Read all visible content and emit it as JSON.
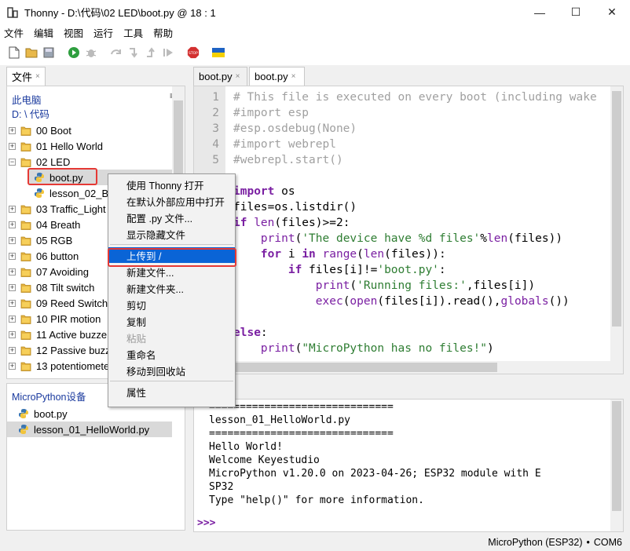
{
  "window": {
    "title": "Thonny  -  D:\\代码\\02 LED\\boot.py  @  18 : 1",
    "minimize": "—",
    "maximize": "☐",
    "close": "✕"
  },
  "menubar": [
    "文件",
    "编辑",
    "视图",
    "运行",
    "工具",
    "帮助"
  ],
  "toolbar": [
    "new-file-icon",
    "open-file-icon",
    "save-icon",
    "run-icon",
    "debug-icon",
    "step-over-icon",
    "step-into-icon",
    "step-out-icon",
    "resume-icon",
    "stop-icon",
    "ukraine-flag-icon"
  ],
  "stop_label": "STOP",
  "files_panel": {
    "tab": "文件",
    "location_title": "此电脑",
    "location_path": "D: \\ 代码",
    "menu_glyph": "≡",
    "items": [
      {
        "label": "00 Boot",
        "type": "folder",
        "expand": "+"
      },
      {
        "label": "01 Hello World",
        "type": "folder",
        "expand": "+"
      },
      {
        "label": "02 LED",
        "type": "folder",
        "expand": "−"
      },
      {
        "label": "boot.py",
        "type": "file"
      },
      {
        "label": "lesson_02_Bl",
        "type": "file"
      },
      {
        "label": "03 Traffic_Light",
        "type": "folder",
        "expand": "+"
      },
      {
        "label": "04 Breath",
        "type": "folder",
        "expand": "+"
      },
      {
        "label": "05 RGB",
        "type": "folder",
        "expand": "+"
      },
      {
        "label": "06 button",
        "type": "folder",
        "expand": "+"
      },
      {
        "label": "07 Avoiding",
        "type": "folder",
        "expand": "+"
      },
      {
        "label": "08 Tilt switch",
        "type": "folder",
        "expand": "+"
      },
      {
        "label": "09 Reed Switch",
        "type": "folder",
        "expand": "+"
      },
      {
        "label": "10 PIR motion",
        "type": "folder",
        "expand": "+"
      },
      {
        "label": "11 Active buzzer",
        "type": "folder",
        "expand": "+"
      },
      {
        "label": "12 Passive buzze",
        "type": "folder",
        "expand": "+"
      },
      {
        "label": "13 potentiomete",
        "type": "folder",
        "expand": "+"
      }
    ]
  },
  "device_panel": {
    "title": "MicroPython设备",
    "items": [
      "boot.py",
      "lesson_01_HelloWorld.py"
    ]
  },
  "editor": {
    "tabs": [
      "boot.py",
      "boot.py"
    ],
    "tab_close": "×",
    "line_numbers": [
      "1",
      "2",
      "3",
      "4",
      "5"
    ],
    "lines": {
      "l1": "# This file is executed on every boot (including wake",
      "l2": "#import esp",
      "l3": "#esp.osdebug(None)",
      "l4": "#import webrepl",
      "l5": "#webrepl.start()",
      "l7_kw": "import",
      "l7_rest": " os",
      "l8": "files=os.listdir()",
      "l9_kw": "if",
      "l9_bi": " len",
      "l9_rest": "(files)>=2:",
      "l10_bi": "    print",
      "l10_open": "(",
      "l10_str": "'The device have %d files'",
      "l10_pct": "%",
      "l10_bi2": "len",
      "l10_rest": "(files))",
      "l11_kw1": "    for",
      "l11_mid": " i ",
      "l11_kw2": "in",
      "l11_bi": " range",
      "l11_open": "(",
      "l11_bi2": "len",
      "l11_rest": "(files)):",
      "l12_kw": "        if",
      "l12_mid": " files[i]!=",
      "l12_str": "'boot.py'",
      "l12_rest": ":",
      "l13_bi": "            print",
      "l13_open": "(",
      "l13_str": "'Running files:'",
      "l13_rest": ",files[i])",
      "l14_bi": "            exec",
      "l14_open": "(",
      "l14_bi2": "open",
      "l14_mid": "(files[i]).read(),",
      "l14_bi3": "globals",
      "l14_rest": "())",
      "l16_kw": "else",
      "l16_rest": ":",
      "l17_bi": "    print",
      "l17_open": "(",
      "l17_str": "\"MicroPython has no files!\"",
      "l17_rest": ")"
    }
  },
  "shell": {
    "lines": [
      "==============================",
      "lesson_01_HelloWorld.py",
      "==============================",
      "Hello World!",
      "Welcome Keyestudio",
      "MicroPython v1.20.0 on 2023-04-26; ESP32 module with E",
      "SP32",
      "Type \"help()\" for more information."
    ],
    "prompt": ">>>"
  },
  "status": {
    "interpreter": "MicroPython (ESP32)",
    "separator": "•",
    "port": "COM6"
  },
  "context_menu": {
    "items": [
      {
        "label": "使用 Thonny 打开",
        "enabled": true
      },
      {
        "label": "在默认外部应用中打开",
        "enabled": true
      },
      {
        "label": "配置 .py 文件...",
        "enabled": true
      },
      {
        "label": "显示隐藏文件",
        "enabled": true
      },
      {
        "label": "上传到 /",
        "enabled": true,
        "highlighted": true
      },
      {
        "label": "新建文件...",
        "enabled": true
      },
      {
        "label": "新建文件夹...",
        "enabled": true
      },
      {
        "label": "剪切",
        "enabled": true
      },
      {
        "label": "复制",
        "enabled": true
      },
      {
        "label": "粘贴",
        "enabled": false
      },
      {
        "label": "重命名",
        "enabled": true
      },
      {
        "label": "移动到回收站",
        "enabled": true
      },
      {
        "label": "属性",
        "enabled": true
      }
    ]
  },
  "colors": {
    "highlight": "#0a64d6",
    "annotation_red": "#e53935",
    "keyword": "#7a1fa2",
    "string": "#2e7d32",
    "comment": "#a0a0a0"
  }
}
